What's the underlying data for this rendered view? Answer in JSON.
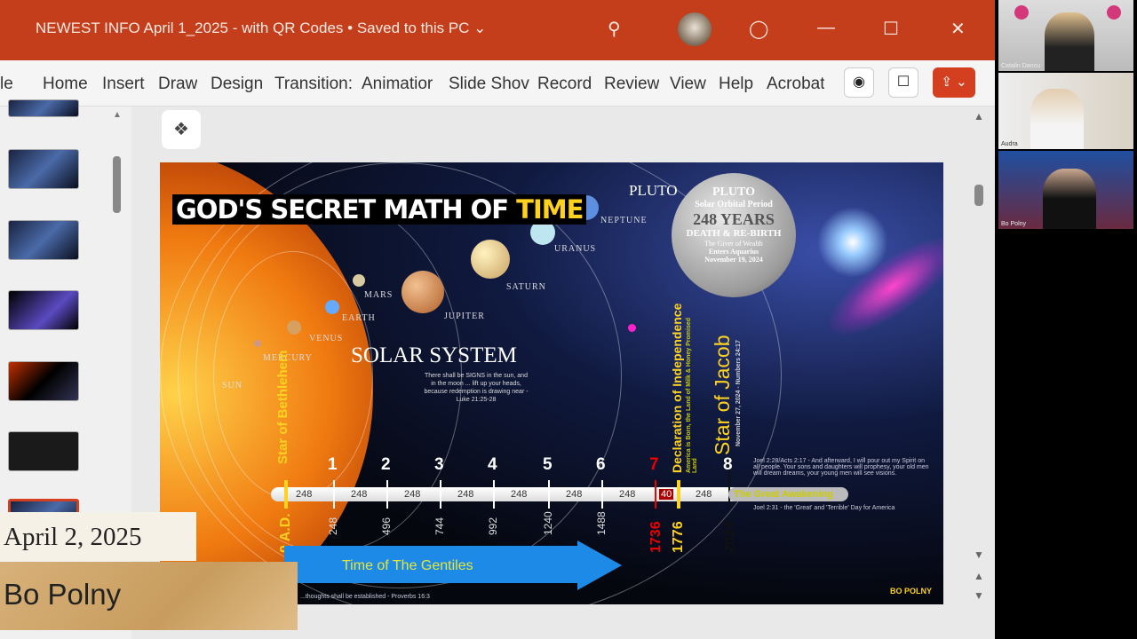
{
  "window": {
    "title": "NEWEST INFO April 1_2025 - with QR Codes • Saved to this PC ⌄",
    "icons": [
      "search-icon",
      "avatar",
      "lightbulb-icon",
      "minimize-icon",
      "maximize-icon",
      "close-icon"
    ]
  },
  "ribbon": {
    "tabs": [
      "le",
      "Home",
      "Insert",
      "Draw",
      "Design",
      "Transition:",
      "Animatior",
      "Slide Shov",
      "Record",
      "Review",
      "View",
      "Help",
      "Acrobat"
    ],
    "record_icon": "◉",
    "comment_icon": "☐",
    "share_label": "⇪ ⌄"
  },
  "slide": {
    "title_a": "GOD'S SECRET MATH OF ",
    "title_b": "TIME",
    "planets": [
      "SUN",
      "MERCURY",
      "VENUS",
      "EARTH",
      "MARS",
      "JUPITER",
      "SATURN",
      "URANUS",
      "NEPTUNE"
    ],
    "pluto_label": "PLUTO",
    "solar_system": "SOLAR SYSTEM",
    "verse": "There shall be SIGNS in the sun, and in the moon ... lift up your heads, because redemption is drawing near - Luke 21:25-28",
    "pluto_disc": {
      "l1": "PLUTO",
      "l2": "Solar Orbital Period",
      "l3": "248 YEARS",
      "l4": "DEATH & RE-BIRTH",
      "l5": "The Giver of Wealth",
      "l6": "Enters Aquarius",
      "l7": "November 19, 2024"
    },
    "star_bethlehem": "Star of Bethlehem",
    "declaration": "Declaration of Independence",
    "declaration_sub": "America is Born, the Land of Milk & Honey Promised Land",
    "star_jacob": "Star of Jacob",
    "star_jacob_sub": "November 27, 2024 - Numbers 24:17",
    "timeline": {
      "numbers": [
        "1",
        "2",
        "3",
        "4",
        "5",
        "6",
        "7",
        "8"
      ],
      "segments": [
        "248",
        "248",
        "248",
        "248",
        "248",
        "248",
        "248",
        "40",
        "248"
      ],
      "years": [
        "0 A.D.",
        "248",
        "496",
        "744",
        "992",
        "1240",
        "1488",
        "1736",
        "1776",
        "2024"
      ]
    },
    "great_awakening": "The Great Awakening",
    "joel1": "Joel 2:28/Acts 2:17 - And afterward, I will pour out my Spirit on all people. Your sons and daughters will prophesy, your old men will dream dreams, your young men will see visions.",
    "joel2": "Joel 2:31 - the 'Great' and 'Terrible' Day for America",
    "gentiles": "Time of The Gentiles",
    "footer": "...thoughts shall be established - Proverbs 16:3",
    "logo": "BO POLNY"
  },
  "video": {
    "participants": [
      "Catalin Dancu",
      "Audra",
      "Bo Polny"
    ]
  },
  "lower_third": {
    "date": "April 2, 2025",
    "name": "Bo Polny"
  },
  "colors": {
    "titlebar": "#c43e1c",
    "accent_yellow": "#ffd21f",
    "gentiles_blue": "#1d8ae8"
  }
}
